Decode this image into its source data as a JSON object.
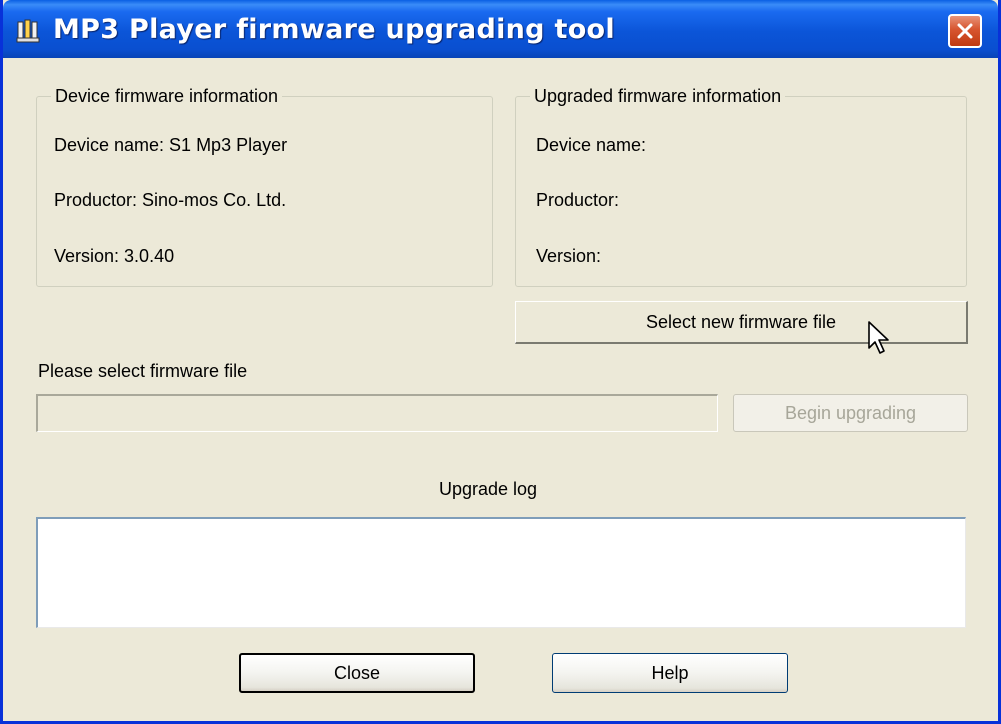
{
  "window": {
    "title": "MP3 Player firmware upgrading tool",
    "icons": {
      "app": "app-icon",
      "close": "close-icon",
      "cursor": "mouse-pointer-icon"
    },
    "colors": {
      "titlebar": "#0a55d8",
      "close_button": "#d7552f",
      "face": "#ece9d8"
    }
  },
  "device_info": {
    "legend": "Device firmware information",
    "device_name": "Device name: S1 Mp3 Player",
    "productor": "Productor: Sino-mos Co. Ltd.",
    "version": "Version: 3.0.40"
  },
  "upgraded_info": {
    "legend": "Upgraded firmware information",
    "device_name": "Device name:",
    "productor": "Productor:",
    "version": "Version:"
  },
  "buttons": {
    "select_file": "Select new firmware file",
    "begin_upgrading": "Begin upgrading",
    "close": "Close",
    "help": "Help"
  },
  "file_selection": {
    "prompt": "Please select firmware file",
    "path_value": ""
  },
  "log": {
    "label": "Upgrade log",
    "content": ""
  }
}
